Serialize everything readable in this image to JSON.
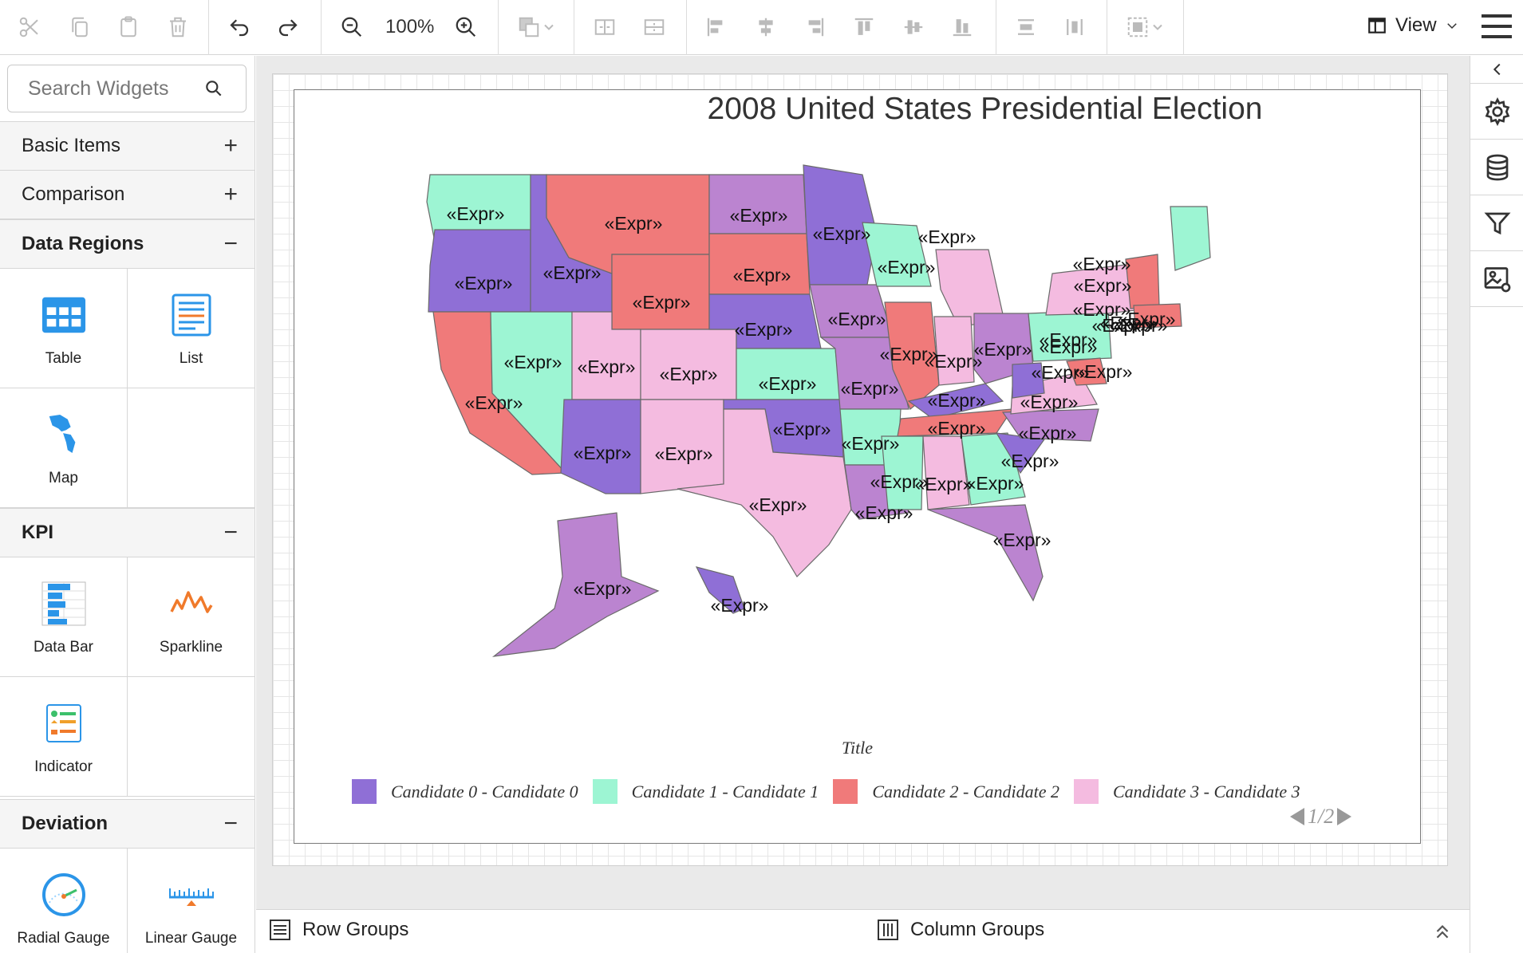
{
  "toolbar": {
    "zoom_level": "100%",
    "view_label": "View",
    "icons": [
      "cut-icon",
      "copy-icon",
      "paste-icon",
      "delete-icon",
      "undo-icon",
      "redo-icon",
      "zoom-out-icon",
      "zoom-in-icon",
      "order-icon",
      "split-h-icon",
      "split-v-icon",
      "align-left-icon",
      "align-center-icon",
      "align-right-icon",
      "align-top-icon",
      "align-middle-icon",
      "align-bottom-icon",
      "distribute-h-icon",
      "distribute-v-icon",
      "group-icon",
      "view-icon",
      "hamburger-icon"
    ]
  },
  "leftpanel": {
    "search_placeholder": "Search Widgets",
    "sections": {
      "basic": {
        "label": "Basic Items",
        "toggle": "+"
      },
      "comparison": {
        "label": "Comparison",
        "toggle": "+"
      },
      "data_regions": {
        "label": "Data Regions",
        "toggle": "−"
      },
      "kpi": {
        "label": "KPI",
        "toggle": "−"
      },
      "deviation": {
        "label": "Deviation",
        "toggle": "−"
      }
    },
    "widgets": {
      "table": "Table",
      "list": "List",
      "map": "Map",
      "data_bar": "Data Bar",
      "sparkline": "Sparkline",
      "indicator": "Indicator",
      "radial_gauge": "Radial Gauge",
      "linear_gauge": "Linear Gauge"
    }
  },
  "report": {
    "title": "2008 United States Presidential Election",
    "state_label": "«Expr»",
    "legend_title": "Title",
    "legend": [
      {
        "label": "Candidate 0 - Candidate 0",
        "color": "#8f6fd6"
      },
      {
        "label": "Candidate 1 - Candidate 1",
        "color": "#9df5d3"
      },
      {
        "label": "Candidate 2 - Candidate 2",
        "color": "#f07a7a"
      },
      {
        "label": "Candidate 3 - Candidate 3",
        "color": "#f4bbe0"
      }
    ],
    "pager": "1/2"
  },
  "colors": {
    "candidate0": "#8f6fd6",
    "candidate1": "#9df5d3",
    "candidate2": "#f07a7a",
    "candidate3": "#f4bbe0",
    "alt_purple": "#bb84d0"
  },
  "bottombar": {
    "row_groups": "Row Groups",
    "column_groups": "Column Groups"
  },
  "rightpanel": {
    "icons": [
      "collapse-icon",
      "settings-icon",
      "database-icon",
      "filter-icon",
      "image-settings-icon"
    ]
  }
}
